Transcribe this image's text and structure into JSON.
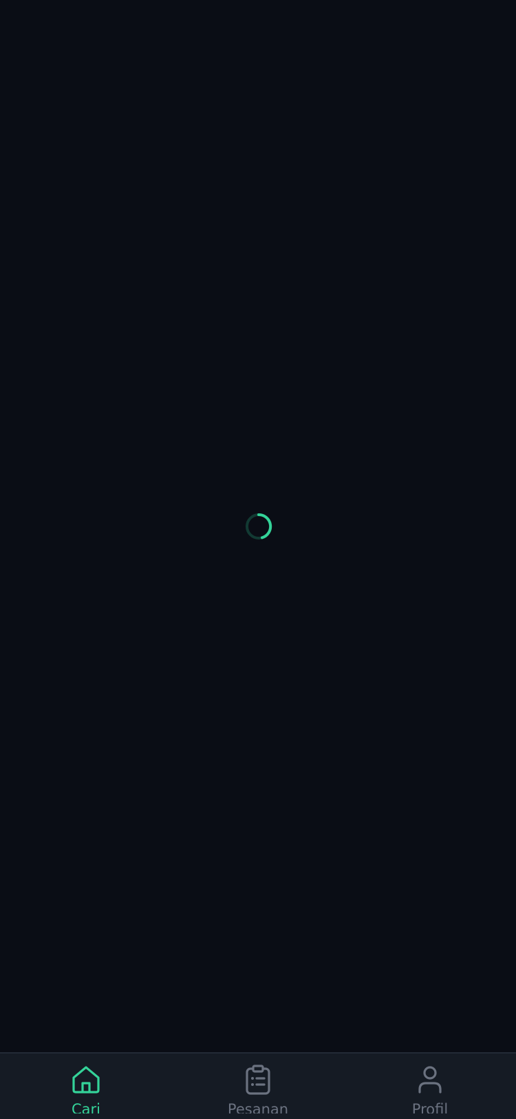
{
  "status": {
    "loading": true
  },
  "colors": {
    "background": "#0a0d15",
    "nav_background": "#151b24",
    "accent": "#34d399",
    "inactive": "#6b7280",
    "spinner_track": "#123a33"
  },
  "bottom_nav": {
    "items": [
      {
        "label": "Cari",
        "icon": "home-icon",
        "active": true
      },
      {
        "label": "Pesanan",
        "icon": "clipboard-list-icon",
        "active": false
      },
      {
        "label": "Profil",
        "icon": "user-icon",
        "active": false
      }
    ]
  }
}
